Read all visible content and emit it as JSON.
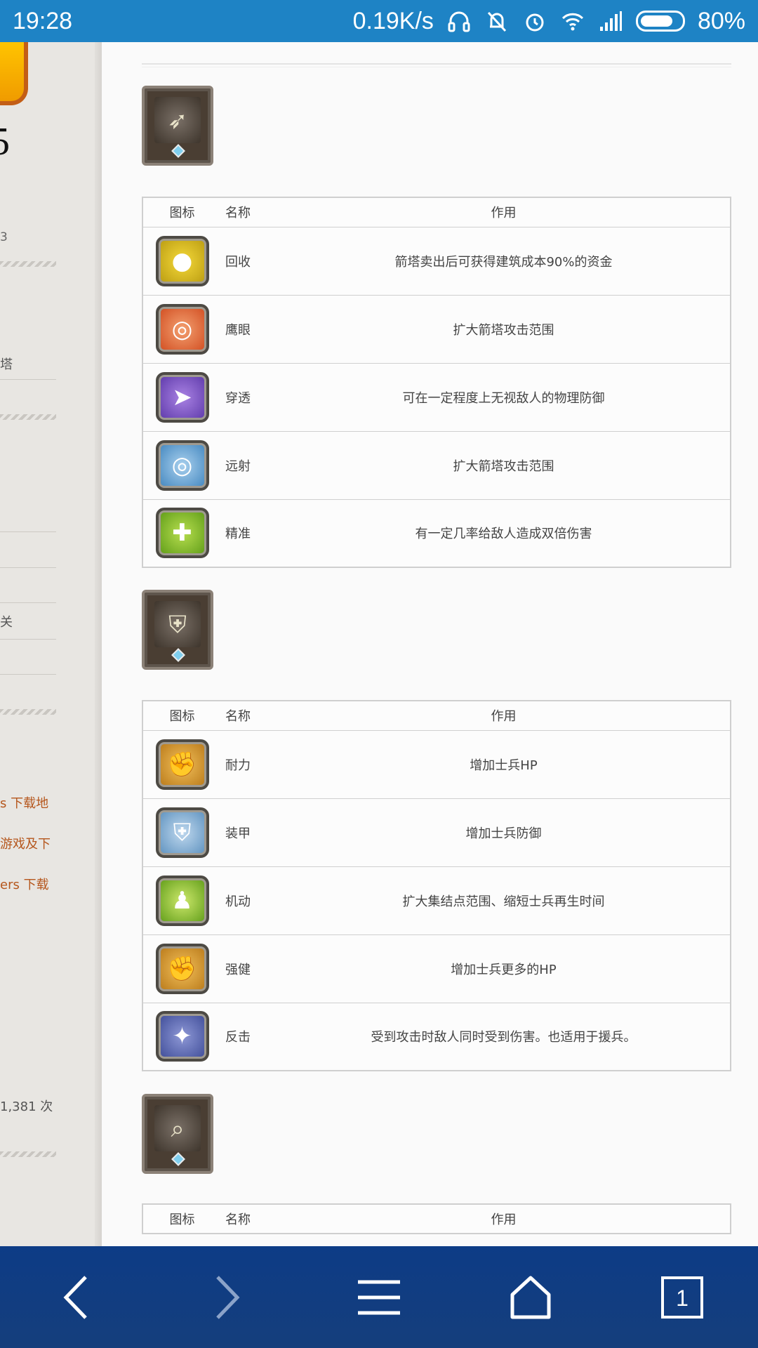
{
  "status_bar": {
    "time": "19:28",
    "net_speed": "0.19K/s",
    "battery_percent": "80%",
    "battery_level": 0.8,
    "icons": [
      "headphones-icon",
      "mute-notification-icon",
      "alarm-icon",
      "wifi-icon",
      "signal-icon",
      "battery-icon"
    ]
  },
  "sidebar": {
    "big_char": "5",
    "small_text_1": "3",
    "nav_fragment": "塔",
    "nav_fragment_2": "关",
    "links": [
      "s 下载地",
      "游戏及下",
      "ers 下载"
    ],
    "view_count": "1,381 次"
  },
  "main": {
    "tables": [
      {
        "category_icon": "arrow-tower-icon",
        "headers": {
          "icon": "图标",
          "name": "名称",
          "desc": "作用"
        },
        "rows": [
          {
            "icon": "coins-icon",
            "name": "回收",
            "desc": "箭塔卖出后可获得建筑成本90%的资金"
          },
          {
            "icon": "target-icon",
            "name": "鹰眼",
            "desc": "扩大箭塔攻击范围"
          },
          {
            "icon": "arrow-pierce-icon",
            "name": "穿透",
            "desc": "可在一定程度上无视敌人的物理防御"
          },
          {
            "icon": "target-blue-icon",
            "name": "远射",
            "desc": "扩大箭塔攻击范围"
          },
          {
            "icon": "crossbow-apple-icon",
            "name": "精准",
            "desc": "有一定几率给敌人造成双倍伤害"
          }
        ]
      },
      {
        "category_icon": "shield-tower-icon",
        "headers": {
          "icon": "图标",
          "name": "名称",
          "desc": "作用"
        },
        "rows": [
          {
            "icon": "muscle-icon",
            "name": "耐力",
            "desc": "增加士兵HP"
          },
          {
            "icon": "armor-shield-icon",
            "name": "装甲",
            "desc": "增加士兵防御"
          },
          {
            "icon": "soldier-icon",
            "name": "机动",
            "desc": "扩大集结点范围、缩短士兵再生时间"
          },
          {
            "icon": "muscle-strong-icon",
            "name": "强健",
            "desc": "增加士兵更多的HP"
          },
          {
            "icon": "counter-attack-icon",
            "name": "反击",
            "desc": "受到攻击时敌人同时受到伤害。也适用于援兵。"
          }
        ]
      },
      {
        "category_icon": "magnifier-tower-icon",
        "headers": {
          "icon": "图标",
          "name": "名称",
          "desc": "作用"
        },
        "rows": []
      }
    ]
  },
  "bottom_nav": {
    "tab_count": "1",
    "buttons": [
      "back-icon",
      "forward-icon",
      "menu-icon",
      "home-icon",
      "tabs-icon"
    ]
  }
}
